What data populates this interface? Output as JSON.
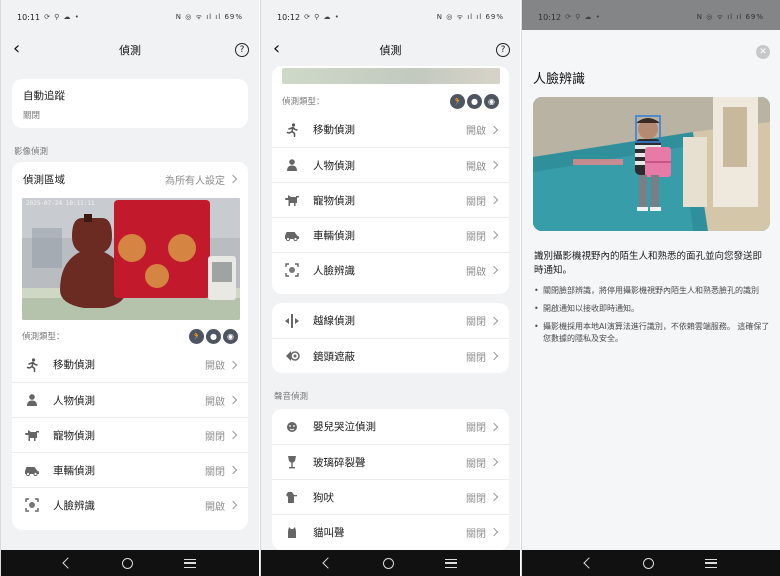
{
  "status": {
    "p1_time": "10:11",
    "p2_time": "10:12",
    "p3_time": "10:12",
    "battery": "69%",
    "left_glyphs": "⟳ ⚲ ☁ •",
    "right_glyphs": "N ◎ ᯤ ıl ıl"
  },
  "screen1": {
    "back_icon": "‹",
    "title": "偵測",
    "help_icon": "?",
    "auto_track": {
      "label": "自動追蹤",
      "value": "關閉"
    },
    "section_video": "影像偵測",
    "zone": {
      "label": "偵測區域",
      "value": "為所有人設定"
    },
    "detect_types_label": "偵測類型：",
    "rows": [
      {
        "label": "移動偵測",
        "value": "開啟",
        "icon": "running-person-icon",
        "glyph": "🏃"
      },
      {
        "label": "人物偵測",
        "value": "開啟",
        "icon": "person-icon",
        "glyph": "👤"
      },
      {
        "label": "寵物偵測",
        "value": "關閉",
        "icon": "dog-icon",
        "glyph": "🐕"
      },
      {
        "label": "車輛偵測",
        "value": "關閉",
        "icon": "car-icon",
        "glyph": "🚗"
      },
      {
        "label": "人臉辨識",
        "value": "開啟",
        "icon": "face-scan-icon",
        "glyph": "[ ]"
      }
    ],
    "camera_timestamp": "2025-07-24 10:11:11"
  },
  "screen2": {
    "title": "偵測",
    "help_icon": "?",
    "back_icon": "‹",
    "detect_types_label": "偵測類型：",
    "rows_a": [
      {
        "label": "移動偵測",
        "value": "開啟",
        "icon": "running-person-icon"
      },
      {
        "label": "人物偵測",
        "value": "開啟",
        "icon": "person-icon"
      },
      {
        "label": "寵物偵測",
        "value": "關閉",
        "icon": "dog-icon"
      },
      {
        "label": "車輛偵測",
        "value": "關閉",
        "icon": "car-icon"
      },
      {
        "label": "人臉辨識",
        "value": "開啟",
        "icon": "face-scan-icon"
      }
    ],
    "rows_b": [
      {
        "label": "越線偵測",
        "value": "關閉",
        "icon": "line-crossing-icon"
      },
      {
        "label": "鏡頭遮蔽",
        "value": "關閉",
        "icon": "lens-cover-icon"
      }
    ],
    "section_audio": "聲音偵測",
    "rows_c": [
      {
        "label": "嬰兒哭泣偵測",
        "value": "關閉",
        "icon": "baby-icon"
      },
      {
        "label": "玻璃碎裂聲",
        "value": "關閉",
        "icon": "wine-glass-icon"
      },
      {
        "label": "狗吠",
        "value": "關閉",
        "icon": "barking-dog-icon"
      },
      {
        "label": "貓叫聲",
        "value": "關閉",
        "icon": "cat-icon"
      }
    ]
  },
  "screen3": {
    "title": "人臉辨識",
    "close_icon": "✕",
    "description": "識別攝影機視野內的陌生人和熟悉的面孔並向您發送即時通知。",
    "bullets": [
      "關閉臉部辨識，將停用攝影機視野內陌生人和熟悉臉孔的識別",
      "開啟通知以接收即時通知。",
      "攝影機採用本地AI演算法進行識別，不依賴雲端服務。 這確保了您數據的隱私及安全。"
    ]
  },
  "colors": {
    "accent_icon_bg": "#4e5561",
    "screen_bg": "#f1f2f4",
    "overlay": "#838587",
    "face_box": "#3b7fd6"
  }
}
